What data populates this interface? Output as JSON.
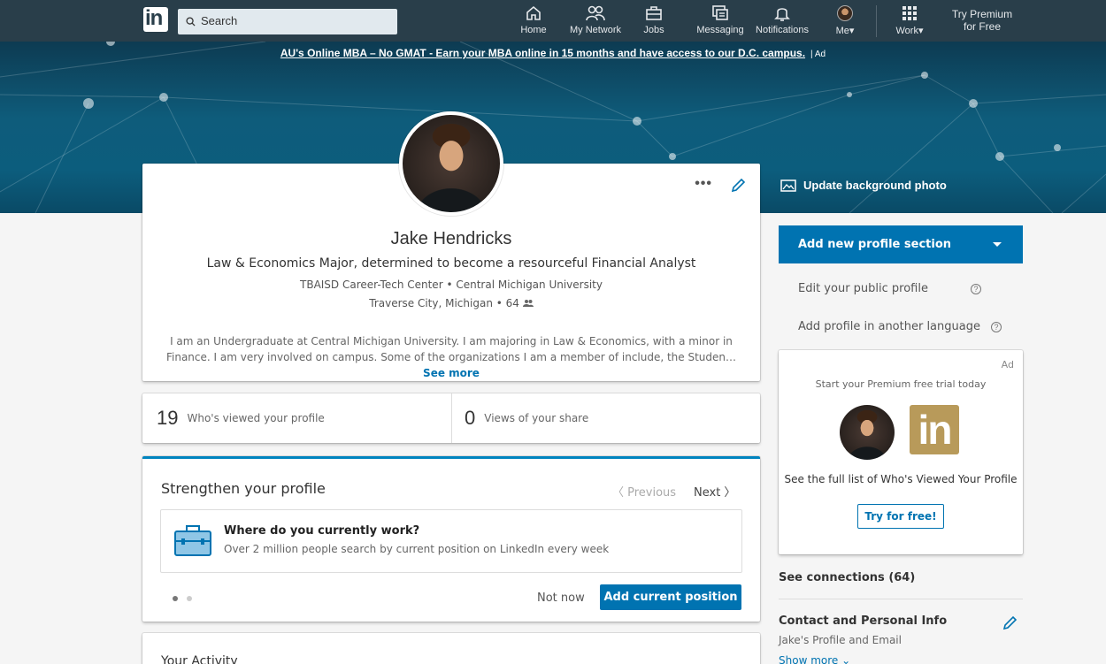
{
  "nav": {
    "logo_text": "in",
    "search_placeholder": "Search",
    "items": [
      {
        "label": "Home",
        "icon": "home-icon"
      },
      {
        "label": "My Network",
        "icon": "people-icon"
      },
      {
        "label": "Jobs",
        "icon": "briefcase-icon"
      },
      {
        "label": "Messaging",
        "icon": "messaging-icon"
      },
      {
        "label": "Notifications",
        "icon": "bell-icon"
      },
      {
        "label": "Me▾",
        "icon": "avatar"
      },
      {
        "label": "Work▾",
        "icon": "grid-icon"
      }
    ],
    "premium_line1": "Try Premium",
    "premium_line2": "for Free"
  },
  "banner": {
    "ad_text": "AU's Online MBA – No GMAT - Earn your MBA online in 15 months and have access to our D.C. campus.",
    "ad_suffix": "| Ad",
    "update_bg_label": "Update background photo"
  },
  "profile": {
    "name": "Jake Hendricks",
    "headline": "Law & Economics Major, determined to become a resourceful Financial Analyst",
    "education": "TBAISD Career-Tech Center • Central Michigan University",
    "location": "Traverse City, Michigan • 64",
    "summary": "I am an Undergraduate at Central Michigan University. I am majoring in Law & Economics, with a minor in Finance. I am very involved on campus. Some of the organizations I am a member of include, the Studen…",
    "see_more": "See more",
    "more_dots": "•••"
  },
  "stats": {
    "views_count": "19",
    "views_label": "Who's viewed your profile",
    "share_count": "0",
    "share_label": "Views of your share"
  },
  "strength": {
    "title": "Strengthen your profile",
    "prev": "〈 Previous",
    "next": "Next 〉",
    "question": "Where do you currently work?",
    "question_sub": "Over 2 million people search by current position on LinkedIn every week",
    "not_now": "Not now",
    "add_position": "Add current position"
  },
  "activity": {
    "title": "Your Activity"
  },
  "rail": {
    "add_section": "Add new profile section",
    "edit_public": "Edit your public profile",
    "add_language": "Add profile in another language",
    "help_glyph": "?",
    "ad": {
      "label": "Ad",
      "headline": "Start your Premium free trial today",
      "logo_text": "in",
      "sub": "See the full list of Who's Viewed Your Profile",
      "button": "Try for free!"
    },
    "connections": "See connections (64)",
    "contact_title": "Contact and Personal Info",
    "contact_sub": "Jake's Profile and Email",
    "show_more": "Show more ⌄"
  },
  "colors": {
    "nav_bg": "#293e4a",
    "accent": "#0073b1",
    "top_border": "#0084bf"
  }
}
